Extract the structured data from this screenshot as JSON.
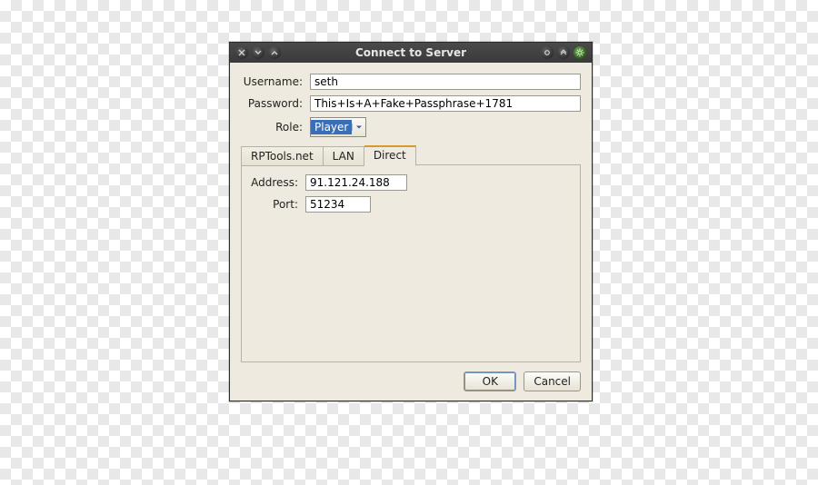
{
  "window": {
    "title": "Connect to Server"
  },
  "form": {
    "username_label": "Username:",
    "username_value": "seth",
    "password_label": "Password:",
    "password_value": "This+Is+A+Fake+Passphrase+1781",
    "role_label": "Role:",
    "role_value": "Player"
  },
  "tabs": {
    "items": [
      "RPTools.net",
      "LAN",
      "Direct"
    ],
    "active_index": 2,
    "direct": {
      "address_label": "Address:",
      "address_value": "91.121.24.188",
      "port_label": "Port:",
      "port_value": "51234"
    }
  },
  "buttons": {
    "ok": "OK",
    "cancel": "Cancel"
  }
}
